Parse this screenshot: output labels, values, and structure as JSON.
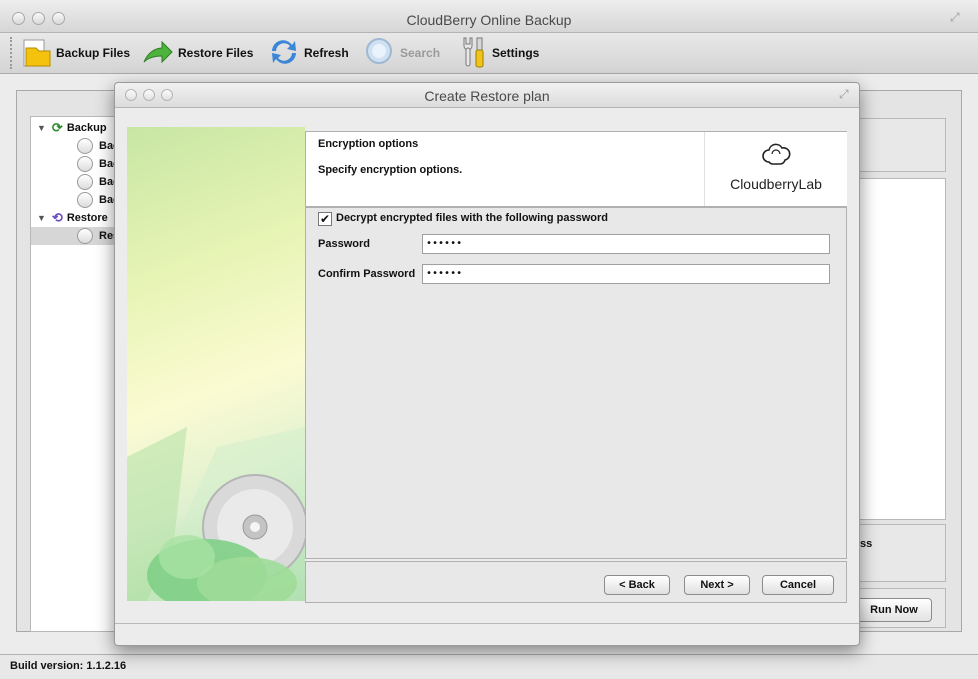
{
  "main_window": {
    "title": "CloudBerry Online Backup"
  },
  "toolbar": {
    "backup_files": "Backup Files",
    "restore_files": "Restore Files",
    "refresh": "Refresh",
    "search": "Search",
    "settings": "Settings"
  },
  "tree": {
    "backup_label": "Backup",
    "backup_items": [
      "Bac",
      "Bac",
      "Bac",
      "Bac"
    ],
    "restore_label": "Restore",
    "restore_items": [
      "Res"
    ]
  },
  "right_panel": {
    "progress_label_partial": "ss",
    "run_now": "Run Now"
  },
  "statusbar": {
    "build_version": "Build version: 1.1.2.16"
  },
  "dialog": {
    "title": "Create Restore plan",
    "header_title": "Encryption options",
    "header_subtitle": "Specify encryption options.",
    "brand": "CloudberryLab",
    "decrypt_label": "Decrypt encrypted files with the following password",
    "decrypt_checked": true,
    "password_label": "Password",
    "password_value": "••••••",
    "confirm_label": "Confirm Password",
    "confirm_value": "••••••",
    "back": "< Back",
    "next": "Next >",
    "cancel": "Cancel"
  },
  "colors": {
    "window_bg": "#ececec",
    "art_green": "#93d39a",
    "art_yellow": "#fbfbd2"
  }
}
